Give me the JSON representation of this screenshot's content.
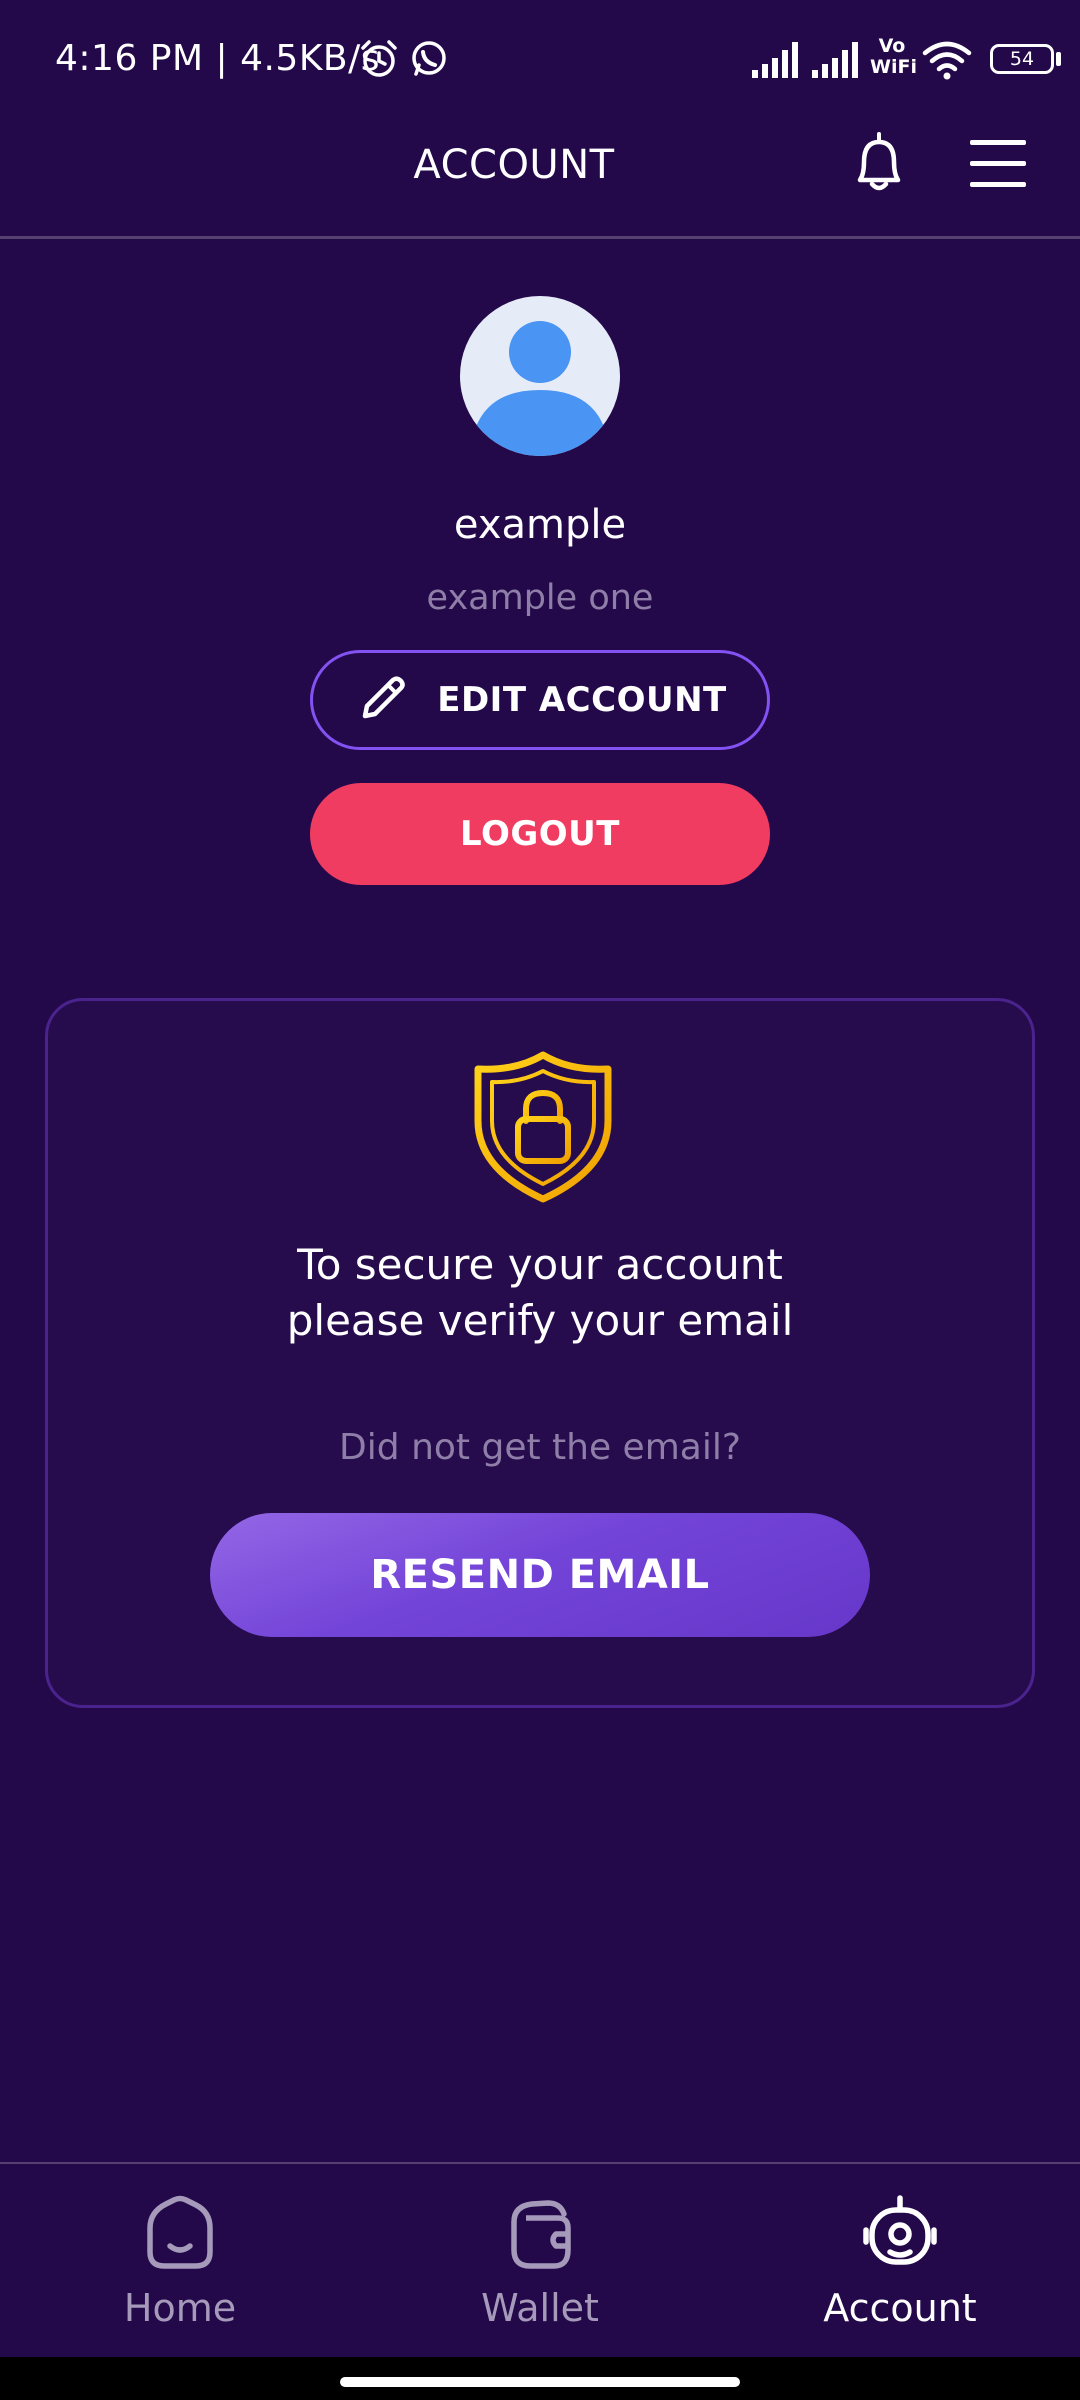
{
  "status_bar": {
    "time": "4:16 PM | 4.5KB/s",
    "battery": "54",
    "network_label_top": "Vo",
    "network_label_bottom": "WiFi"
  },
  "header": {
    "title": "ACCOUNT"
  },
  "profile": {
    "name": "example",
    "subtitle": "example one",
    "edit_label": "EDIT ACCOUNT",
    "logout_label": "LOGOUT"
  },
  "verify_card": {
    "message_line1": "To secure your account",
    "message_line2": "please verify your email",
    "hint": "Did not get the email?",
    "resend_label": "RESEND EMAIL"
  },
  "bottom_nav": {
    "items": [
      {
        "label": "Home",
        "icon": "home-face-icon",
        "active": false
      },
      {
        "label": "Wallet",
        "icon": "wallet-icon",
        "active": false
      },
      {
        "label": "Account",
        "icon": "robot-account-icon",
        "active": true
      }
    ]
  },
  "colors": {
    "background": "#24094a",
    "accent_purple": "#8352f2",
    "logout_red": "#f13c62",
    "shield_gold": "#f5c000",
    "muted_text": "#8f7fa8"
  }
}
